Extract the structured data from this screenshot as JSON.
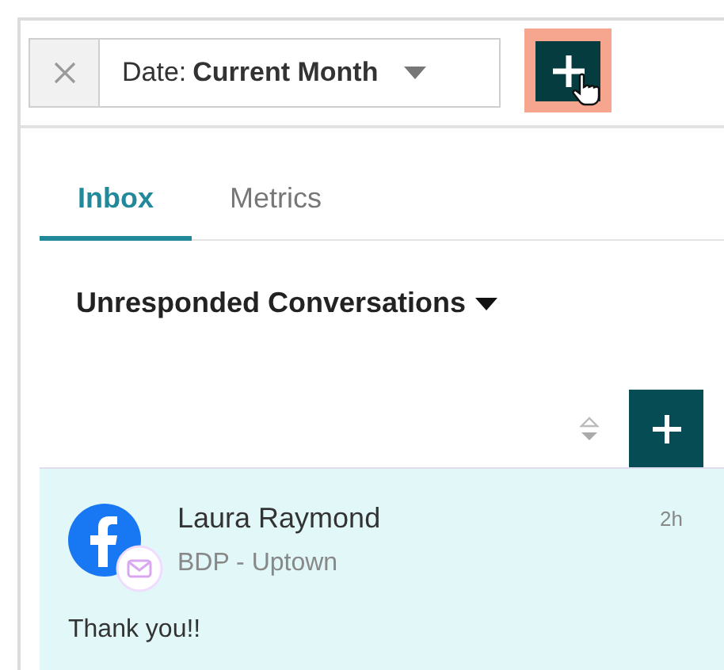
{
  "filter": {
    "label": "Date:",
    "value": "Current Month"
  },
  "tabs": [
    {
      "label": "Inbox",
      "selected": true
    },
    {
      "label": "Metrics",
      "selected": false
    }
  ],
  "heading": "Unresponded Conversations",
  "conversations": [
    {
      "name": "Laura Raymond",
      "location": "BDP - Uptown",
      "time": "2h",
      "message": "Thank you!!",
      "selected": true
    }
  ]
}
